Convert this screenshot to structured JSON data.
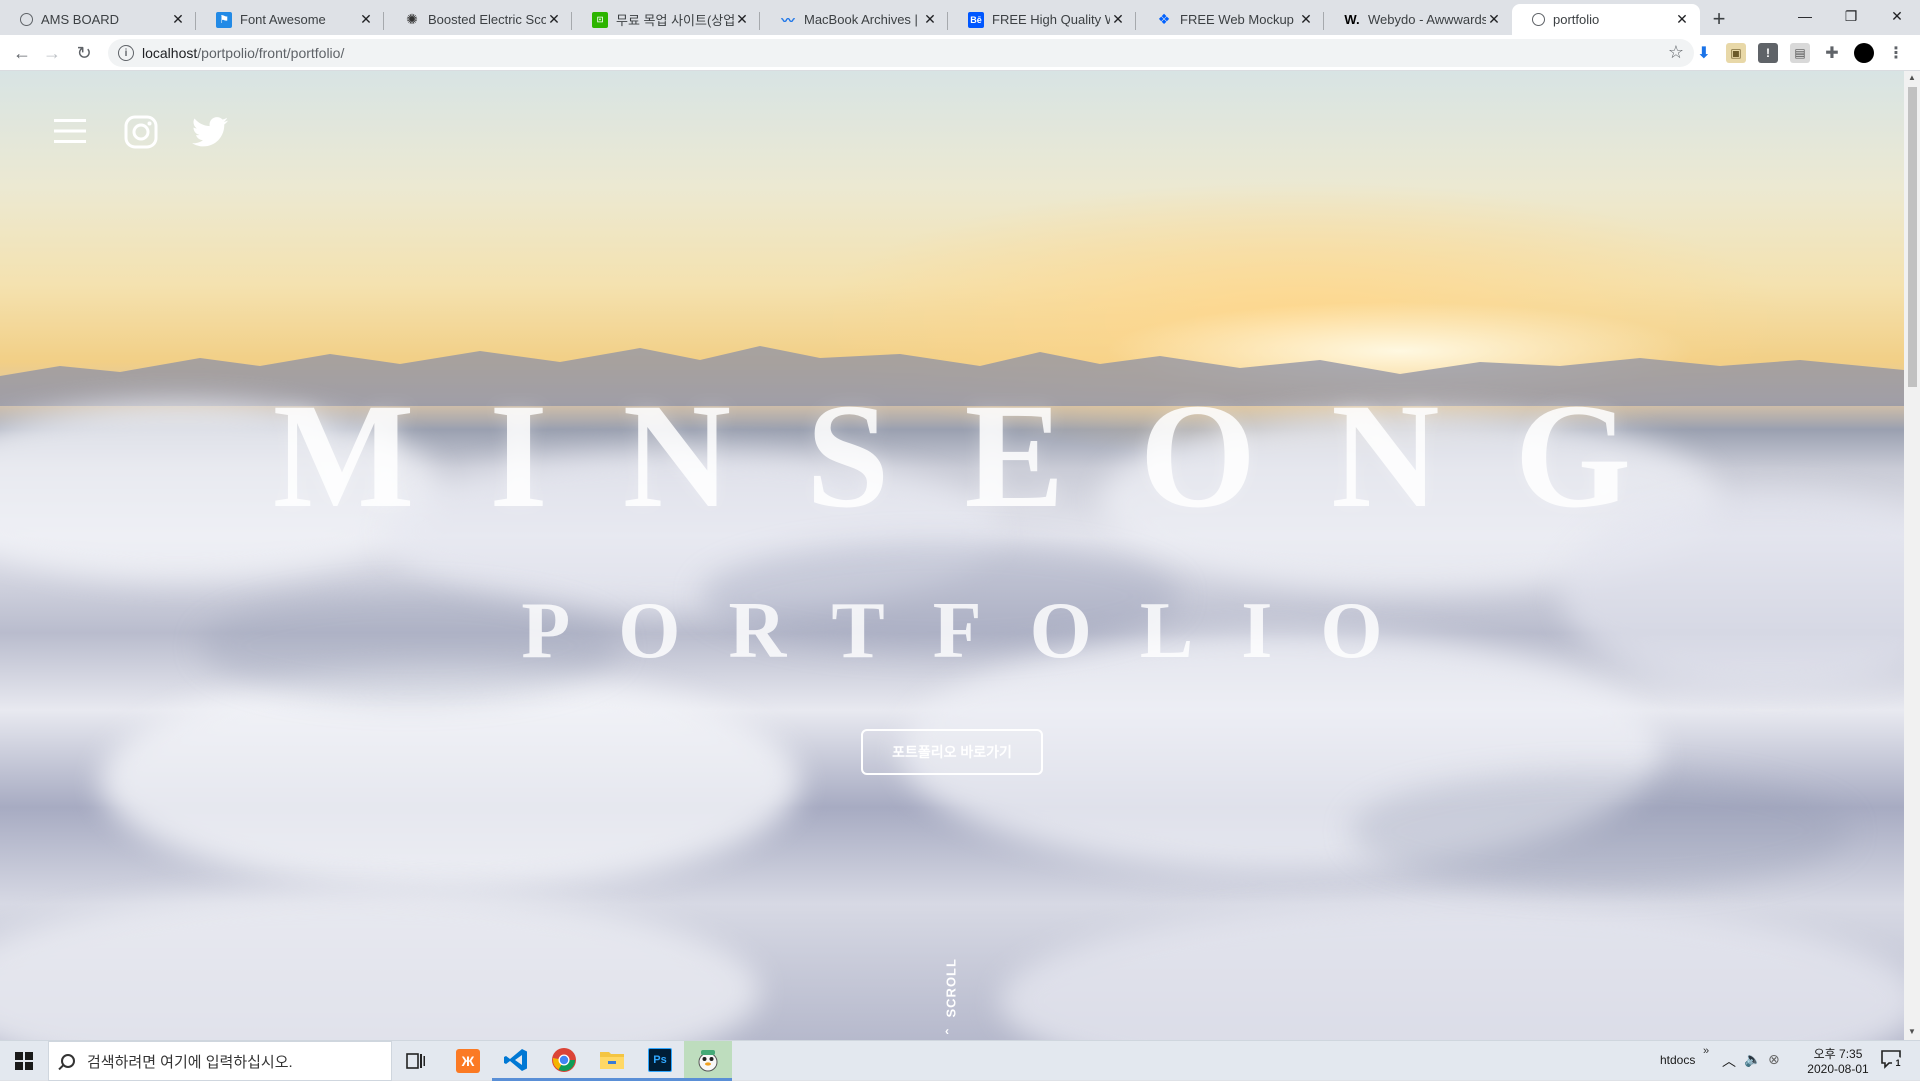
{
  "browser": {
    "tabs": [
      {
        "title": "AMS BOARD",
        "favicon": "globe-icon",
        "active": false
      },
      {
        "title": "Font Awesome",
        "favicon": "font-awesome-flag-icon",
        "active": false
      },
      {
        "title": "Boosted Electric Scooters",
        "favicon": "boosted-logo-icon",
        "active": false
      },
      {
        "title": "무료 목업 사이트(상업",
        "favicon": "green-badge-icon",
        "active": false
      },
      {
        "title": "MacBook Archives | Pa",
        "favicon": "wave-logo-icon",
        "active": false
      },
      {
        "title": "FREE High Quality Web",
        "favicon": "behance-icon",
        "active": false
      },
      {
        "title": "FREE Web Mockup by",
        "favicon": "dropbox-icon",
        "active": false
      },
      {
        "title": "Webydo - Awwwards",
        "favicon": "w-logo-icon",
        "active": false
      },
      {
        "title": "portfolio",
        "favicon": "globe-icon",
        "active": true
      }
    ],
    "address": {
      "host": "localhost",
      "path": "/portpolio/front/portfolio/"
    }
  },
  "page": {
    "title": "MINSEONG",
    "subtitle": "PORTFOLIO",
    "cta_label": "포트폴리오 바로가기",
    "scroll_label": "SCROLL"
  },
  "taskbar": {
    "search_placeholder": "검색하려면 여기에 입력하십시오.",
    "folder_label": "htdocs",
    "time": "오후 7:35",
    "date": "2020-08-01",
    "notification_count": "1"
  },
  "colors": {
    "accent_blue": "#1a73e8",
    "cta_border": "#ffffff",
    "taskbar_bg": "#e3e8ef"
  }
}
